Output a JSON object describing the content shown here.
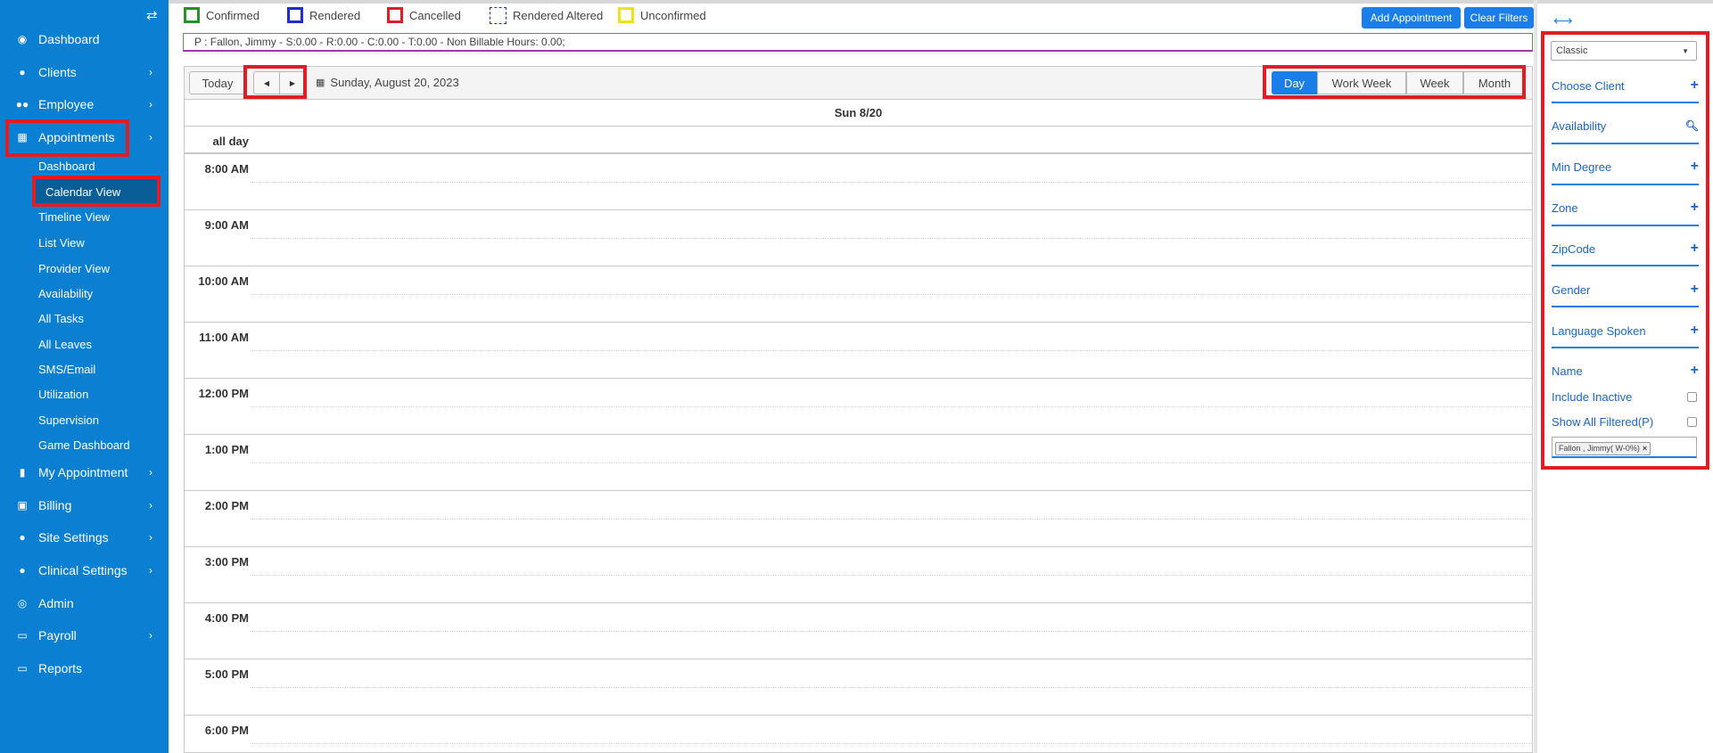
{
  "sidebar": {
    "items": [
      {
        "label": "Dashboard",
        "icon": "dashboard-icon"
      },
      {
        "label": "Clients",
        "icon": "user-icon"
      },
      {
        "label": "Employee",
        "icon": "users-icon"
      },
      {
        "label": "Appointments",
        "icon": "calendar-icon"
      },
      {
        "label": "My Appointment",
        "icon": "book-icon"
      },
      {
        "label": "Billing",
        "icon": "money-icon"
      },
      {
        "label": "Site Settings",
        "icon": "user-icon"
      },
      {
        "label": "Clinical Settings",
        "icon": "user-icon"
      },
      {
        "label": "Admin",
        "icon": "user-circle-icon"
      },
      {
        "label": "Payroll",
        "icon": "card-icon"
      },
      {
        "label": "Reports",
        "icon": "card-icon"
      }
    ],
    "sub_items": [
      "Dashboard",
      "Calendar View",
      "Timeline View",
      "List View",
      "Provider View",
      "Availability",
      "All Tasks",
      "All Leaves",
      "SMS/Email",
      "Utilization",
      "Supervision",
      "Game Dashboard"
    ]
  },
  "legend": {
    "confirmed": "Confirmed",
    "rendered": "Rendered",
    "cancelled": "Cancelled",
    "rendered_altered": "Rendered Altered",
    "unconfirmed": "Unconfirmed"
  },
  "actions": {
    "add_appointment": "Add Appointment",
    "clear_filters": "Clear Filters"
  },
  "info_bar": "P : Fallon, Jimmy - S:0.00 - R:0.00 - C:0.00 - T:0.00 - Non Billable Hours: 0.00;",
  "calendar": {
    "today": "Today",
    "date_label": "Sunday, August 20, 2023",
    "views": [
      "Day",
      "Work Week",
      "Week",
      "Month"
    ],
    "active_view": "Day",
    "day_header": "Sun 8/20",
    "all_day": "all day",
    "times": [
      "8:00 AM",
      "9:00 AM",
      "10:00 AM",
      "11:00 AM",
      "12:00 PM",
      "1:00 PM",
      "2:00 PM",
      "3:00 PM",
      "4:00 PM",
      "5:00 PM",
      "6:00 PM"
    ]
  },
  "filters": {
    "mode": "Classic",
    "rows": [
      "Choose Client",
      "Availability",
      "Min Degree",
      "Zone",
      "ZipCode",
      "Gender",
      "Language Spoken",
      "Name"
    ],
    "include_inactive": "Include Inactive",
    "show_all_filtered": "Show All Filtered(P)",
    "tag": "Fallon , Jimmy( W-0%)"
  },
  "colors": {
    "sidebar": "#0b7fd1",
    "primary": "#1a7ee8",
    "highlight": "#e01c24",
    "confirmed": "#2e8b2e",
    "rendered": "#1f2bd4",
    "cancelled": "#e01c24",
    "unconfirmed": "#f0e21a"
  }
}
